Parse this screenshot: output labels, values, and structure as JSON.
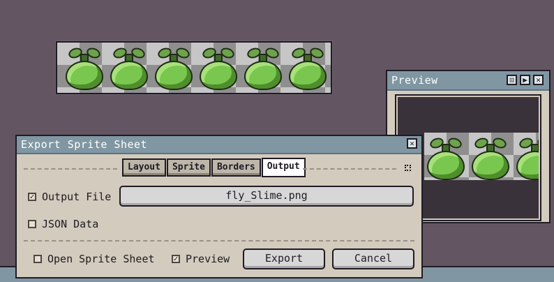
{
  "preview": {
    "title": "Preview",
    "buttons": [
      "⊡",
      "▶",
      "✕"
    ]
  },
  "dialog": {
    "title": "Export Sprite Sheet",
    "close_glyph": "✕",
    "tabs": [
      {
        "label": "Layout",
        "active": false
      },
      {
        "label": "Sprite",
        "active": false
      },
      {
        "label": "Borders",
        "active": false
      },
      {
        "label": "Output",
        "active": true
      }
    ],
    "output_file": {
      "label": "Output File",
      "checked": true,
      "check_glyph": "✓",
      "value": "fly_Slime.png"
    },
    "json_data": {
      "label": "JSON Data",
      "checked": false
    },
    "open_sprite_sheet": {
      "label": "Open Sprite Sheet",
      "checked": false
    },
    "preview_option": {
      "label": "Preview",
      "checked": true,
      "check_glyph": "✓"
    },
    "export_label": "Export",
    "cancel_label": "Cancel"
  },
  "colors": {
    "canvas_bg": "#645563",
    "titlebar": "#8097a3",
    "panel": "#d3cbbd",
    "slime": "#7ac74f"
  }
}
